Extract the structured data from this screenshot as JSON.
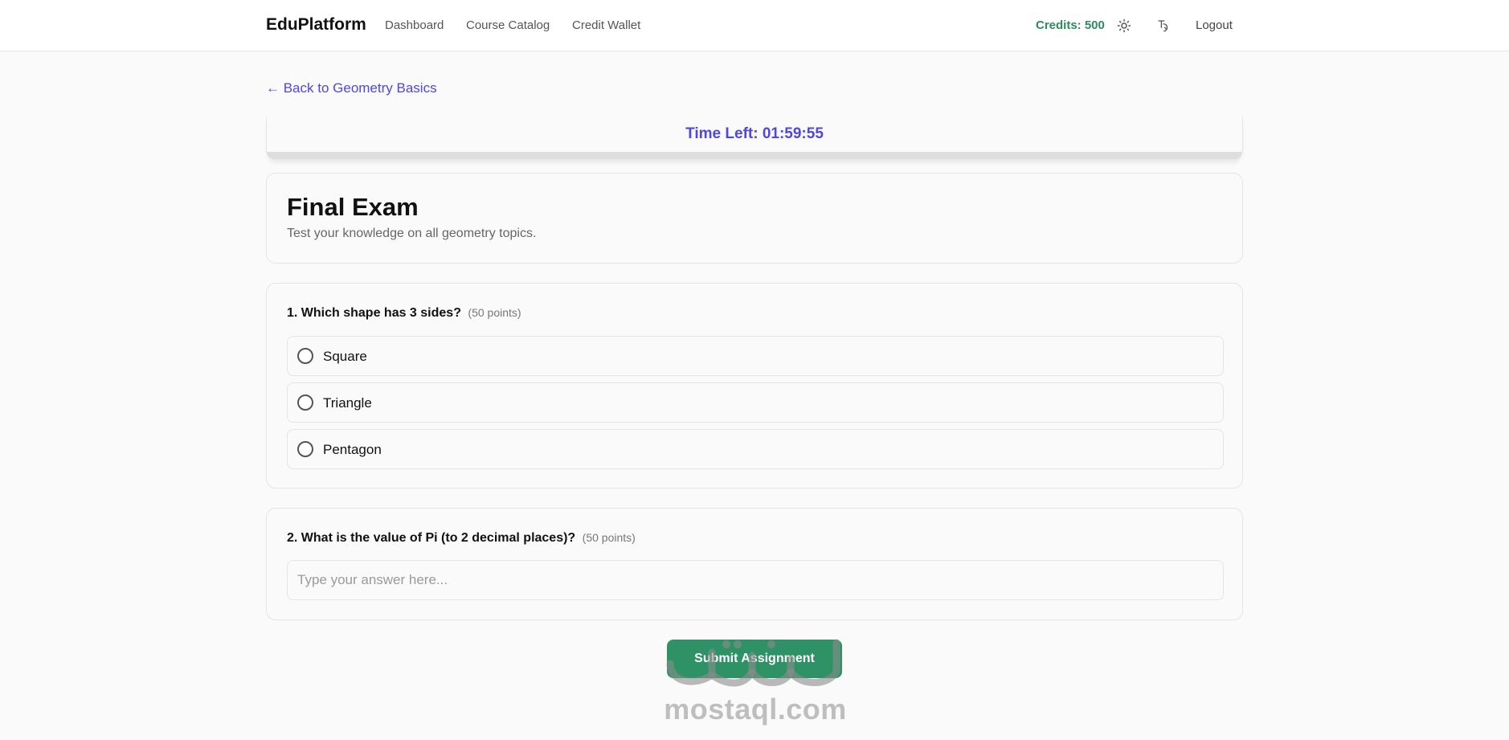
{
  "header": {
    "brand": "EduPlatform",
    "nav": [
      "Dashboard",
      "Course Catalog",
      "Credit Wallet"
    ],
    "credits": "Credits: 500",
    "theme_icon": "sun-icon",
    "language_icon": "translate-icon",
    "logout": "Logout"
  },
  "back_link": "← Back to Geometry Basics",
  "timer": "Time Left: 01:59:55",
  "exam": {
    "title": "Final Exam",
    "description": "Test your knowledge on all geometry topics."
  },
  "questions": [
    {
      "title": "1. Which shape has 3 sides?",
      "points": "(50 points)",
      "options": [
        "Square",
        "Triangle",
        "Pentagon"
      ]
    },
    {
      "title": "2. What is the value of Pi (to 2 decimal places)?",
      "points": "(50 points)",
      "placeholder": "Type your answer here...",
      "value": ""
    }
  ],
  "submit_label": "Submit Assignment",
  "watermark": "mostaql.com",
  "colors": {
    "accent": "#4f46e5",
    "credits": "#2f8a5f",
    "submit": "#2f9266"
  }
}
